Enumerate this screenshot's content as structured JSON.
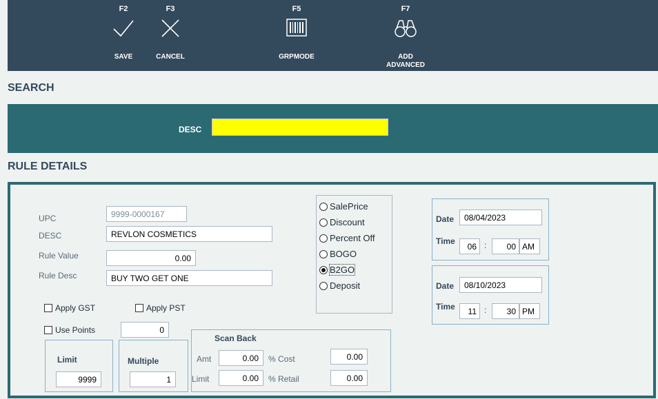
{
  "toolbar": {
    "save": {
      "fkey": "F2",
      "label": "SAVE",
      "icon": "check-icon"
    },
    "cancel": {
      "fkey": "F3",
      "label": "CANCEL",
      "icon": "x-icon"
    },
    "grpmode": {
      "fkey": "F5",
      "label": "GRPMODE",
      "icon": "barcode-icon"
    },
    "add_advanced": {
      "fkey": "F7",
      "label_line1": "ADD",
      "label_line2": "ADVANCED",
      "icon": "binoculars-icon"
    }
  },
  "search": {
    "title": "SEARCH",
    "desc_label": "DESC",
    "desc_value": ""
  },
  "rule_details": {
    "title": "RULE DETAILS",
    "upc_label": "UPC",
    "upc_value": "9999-0000167",
    "desc_label": "DESC",
    "desc_value": "REVLON COSMETICS",
    "rule_value_label": "Rule Value",
    "rule_value": "0.00",
    "rule_desc_label": "Rule Desc",
    "rule_desc_value": "BUY TWO GET ONE",
    "apply_gst_label": "Apply GST",
    "apply_gst": false,
    "apply_pst_label": "Apply PST",
    "apply_pst": false,
    "use_points_label": "Use Points",
    "use_points": false,
    "points_value": "0",
    "limit_label": "Limit",
    "limit_value": "9999",
    "multiple_label": "Multiple",
    "multiple_value": "1",
    "scan_back": {
      "title": "Scan Back",
      "amt_label": "Amt",
      "amt_value": "0.00",
      "limit_label": "Limit",
      "limit_value": "0.00",
      "cost_label": "% Cost",
      "cost_value": "0.00",
      "retail_label": "% Retail",
      "retail_value": "0.00"
    },
    "rule_types": [
      {
        "label": "SalePrice",
        "selected": false
      },
      {
        "label": "Discount",
        "selected": false
      },
      {
        "label": "Percent Off",
        "selected": false
      },
      {
        "label": "BOGO",
        "selected": false
      },
      {
        "label": "B2GO",
        "selected": true
      },
      {
        "label": "Deposit",
        "selected": false
      }
    ],
    "start": {
      "date_label": "Date",
      "date": "08/04/2023",
      "time_label": "Time",
      "hour": "06",
      "colon": ":",
      "minute": "00",
      "ampm": "AM"
    },
    "end": {
      "date_label": "Date",
      "date": "08/10/2023",
      "time_label": "Time",
      "hour": "11",
      "colon": ":",
      "minute": "30",
      "ampm": "PM"
    }
  },
  "colors": {
    "toolbar_bg": "#33495c",
    "band": "#2b6a72",
    "search_field": "#ffff00",
    "page_bg": "#eef2f1"
  }
}
